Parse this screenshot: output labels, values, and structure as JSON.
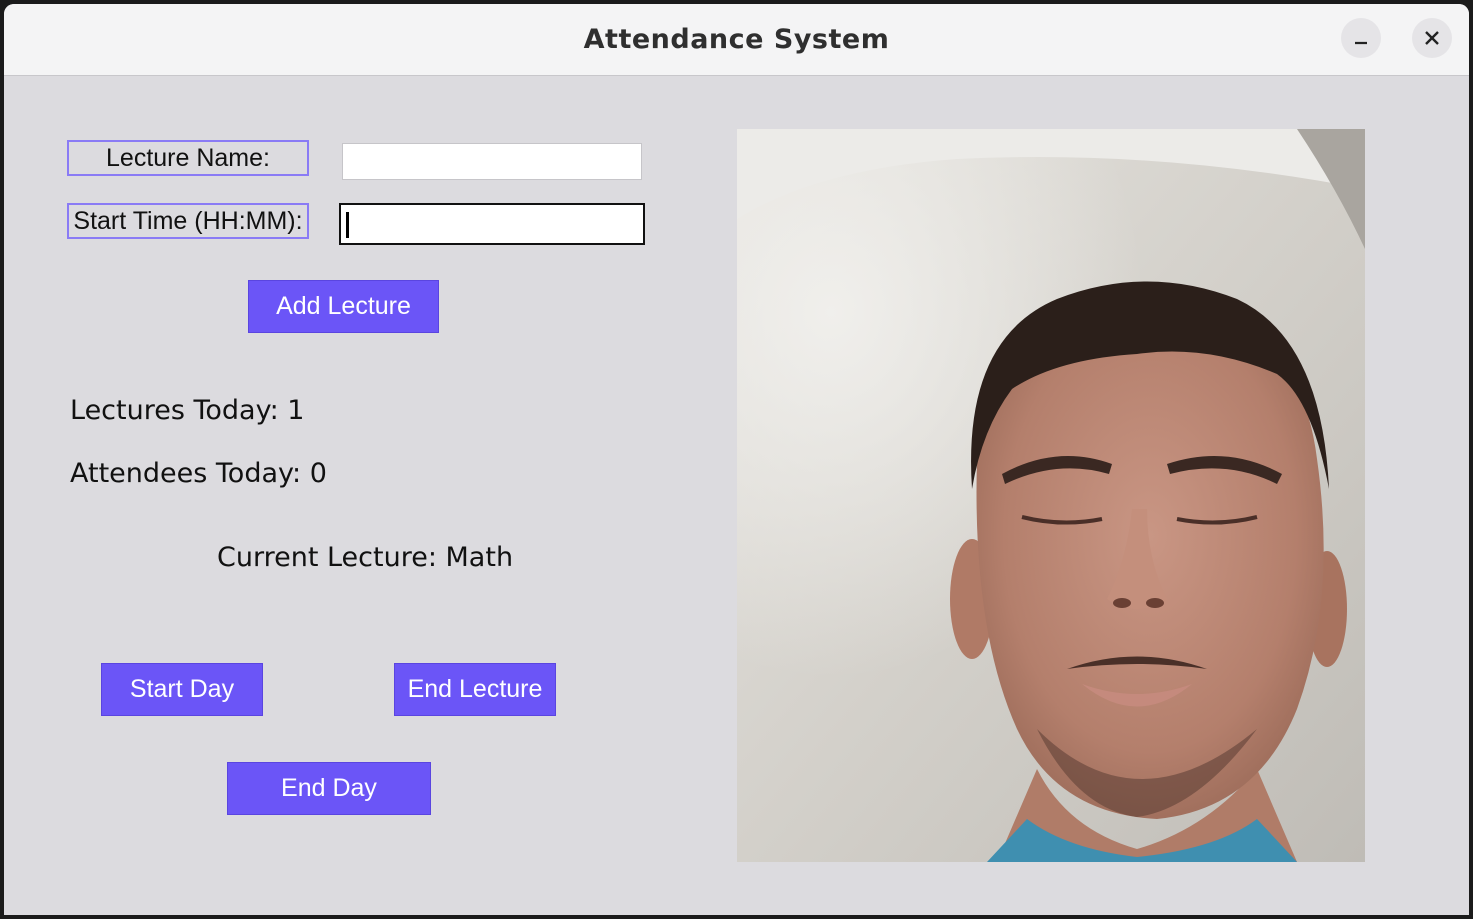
{
  "window": {
    "title": "Attendance System",
    "minimize_icon": "minimize-icon",
    "close_icon": "close-icon"
  },
  "form": {
    "lecture_name_label": "Lecture Name:",
    "lecture_name_value": "",
    "start_time_label": "Start Time (HH:MM):",
    "start_time_value": "",
    "add_lecture_label": "Add Lecture"
  },
  "stats": {
    "lectures_today": "Lectures Today: 1",
    "attendees_today": "Attendees Today: 0",
    "current_lecture": "Current Lecture: Math"
  },
  "actions": {
    "start_day_label": "Start Day",
    "end_lecture_label": "End Lecture",
    "end_day_label": "End Day"
  },
  "colors": {
    "button_bg": "#6b55f7",
    "label_border": "#8a7bf5",
    "window_bg": "#dcdbdf"
  }
}
